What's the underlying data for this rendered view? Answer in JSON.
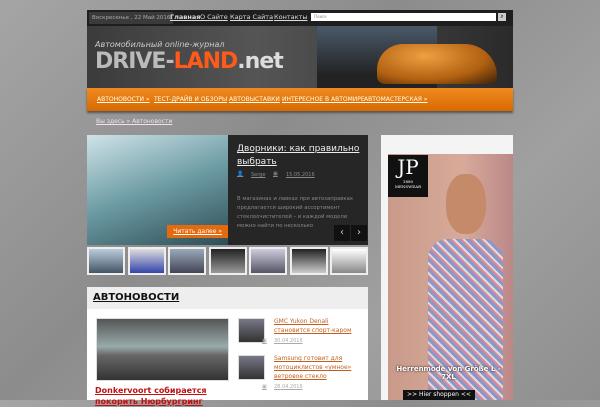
{
  "topbar": {
    "date": "Воскресенье , 22 Май 2016",
    "links": [
      "Главная",
      "О Сайте",
      "Карта Сайта",
      "Контакты"
    ],
    "search_placeholder": "Поиск"
  },
  "header": {
    "tagline": "Автомобильный online-журнал",
    "logo_a": "DRIVE-",
    "logo_b": "LAND",
    "logo_c": ".net"
  },
  "nav": [
    "АВТОНОВОСТИ »",
    "ТЕСТ-ДРАЙВ И ОБЗОРЫ",
    "АВТОВЫСТАВКИ",
    "ИНТЕРЕСНОЕ В АВТОМИРЕ",
    "АВТОМАСТЕРСКАЯ »"
  ],
  "breadcrumb": "Вы здесь » Автоновости",
  "slider": {
    "title": "Дворники: как правильно выбрать",
    "author": "Serge",
    "date": "15.05.2016",
    "text": "В магазинах и лавках при автозаправках предлагается широкий ассортимент стеклоочистителей – и каждой модели можно найти по несколько",
    "read_more": "Читать далее »"
  },
  "news": {
    "heading": "АВТОНОВОСТИ",
    "main_title": "Donkervoort собирается покорить Нюрбургринг",
    "items": [
      {
        "title": "GMC Yukon Denali становится спорт-каром",
        "date": "30.04.2016"
      },
      {
        "title": "Samsung готовит для мотоциклистов «умное» ветровое стекло",
        "date": "28.04.2016"
      }
    ]
  },
  "ad": {
    "brand": "JP",
    "brand_sub": "1880 MENSWEAR",
    "text": "Herrenmode von Größe L - 7XL",
    "button": ">> Hier shoppen <<"
  }
}
